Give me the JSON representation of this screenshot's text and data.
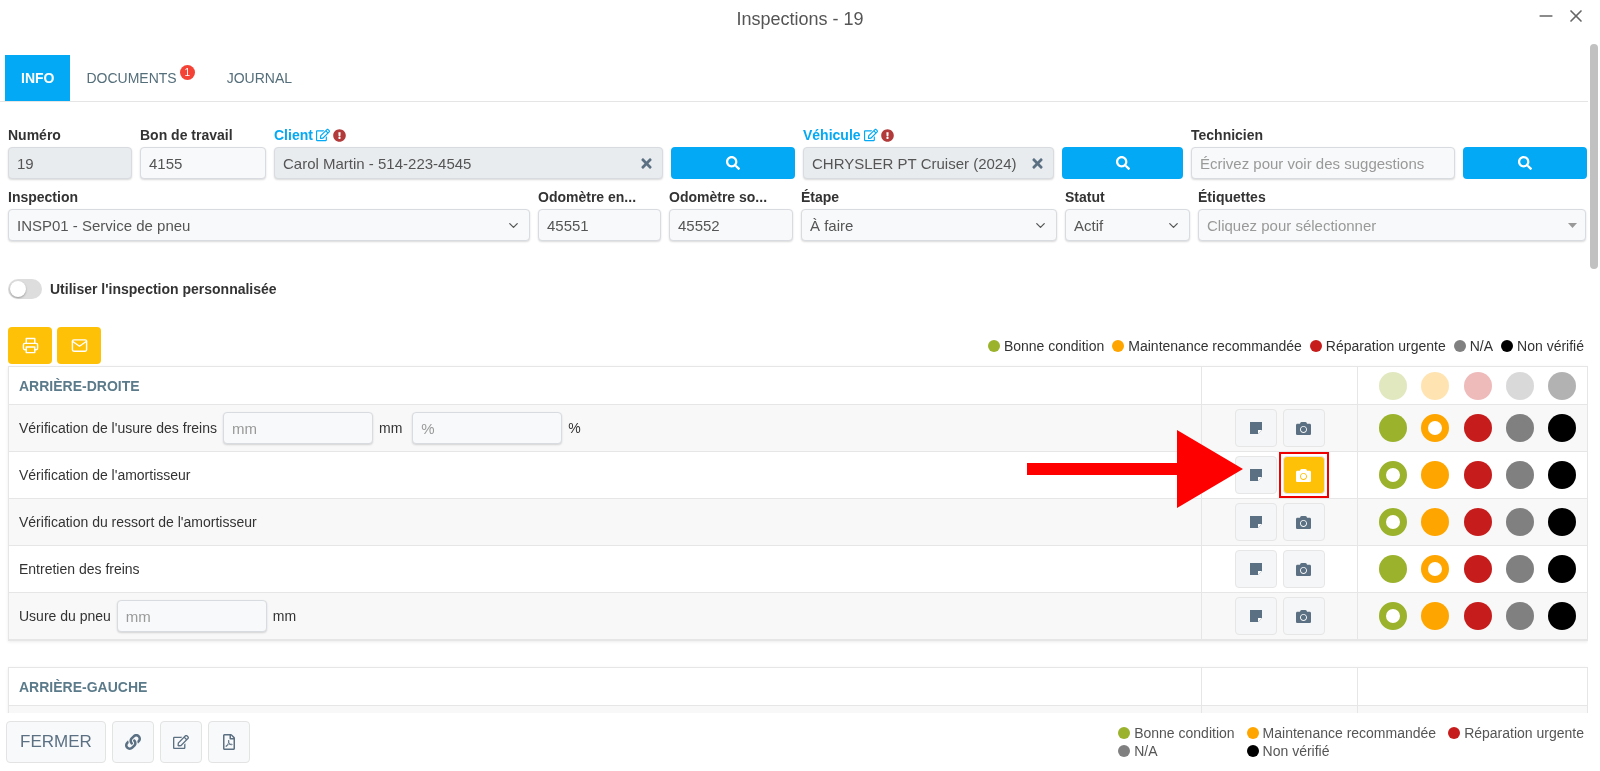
{
  "window": {
    "title": "Inspections - 19"
  },
  "tabs": [
    {
      "label": "INFO",
      "selected": true
    },
    {
      "label": "DOCUMENTS",
      "selected": false,
      "badge": "1"
    },
    {
      "label": "JOURNAL",
      "selected": false
    }
  ],
  "form": {
    "fields_top": [
      {
        "kind": "text",
        "label": "Numéro",
        "value": "19",
        "disabled": true
      },
      {
        "kind": "text",
        "label": "Bon de travail",
        "value": "4155",
        "disabled": false
      },
      {
        "kind": "lookup",
        "label": "Client",
        "value": "Carol Martin - 514-223-4545"
      },
      {
        "kind": "search"
      },
      {
        "kind": "lookup",
        "label": "Véhicule",
        "value": "CHRYSLER PT Cruiser (2024)"
      },
      {
        "kind": "search"
      },
      {
        "kind": "text",
        "label": "Technicien",
        "placeholder": "Écrivez pour voir des suggestions",
        "disabled": false
      },
      {
        "kind": "search"
      }
    ],
    "fields_bottom": [
      {
        "kind": "select",
        "label": "Inspection",
        "value": "INSP01 - Service de pneu"
      },
      {
        "kind": "text",
        "label": "Odomètre en...",
        "value": "45551",
        "disabled": false
      },
      {
        "kind": "text",
        "label": "Odomètre so...",
        "value": "45552",
        "disabled": false
      },
      {
        "kind": "select",
        "label": "Étape",
        "value": "À faire"
      },
      {
        "kind": "select",
        "label": "Statut",
        "value": "Actif"
      },
      {
        "kind": "tags",
        "label": "Étiquettes",
        "placeholder": "Cliquez pour sélectionner"
      }
    ]
  },
  "custom_toggle": {
    "label": "Utiliser l'inspection personnalisée",
    "on": false
  },
  "legend": [
    {
      "label": "Bonne condition",
      "color": "#9ab22c"
    },
    {
      "label": "Maintenance recommandée",
      "color": "#ffa500"
    },
    {
      "label": "Réparation urgente",
      "color": "#c71c1c"
    },
    {
      "label": "N/A",
      "color": "#808080"
    },
    {
      "label": "Non vérifié",
      "color": "#000000"
    }
  ],
  "sections": [
    {
      "title": "ARRIÈRE-DROITE",
      "items": [
        {
          "label": "Vérification de l'usure des freins",
          "measures": [
            {
              "placeholder": "mm",
              "unit": "mm"
            },
            {
              "placeholder": "%",
              "unit": "%"
            }
          ],
          "photo_highlighted": false,
          "conditions": [
            {
              "selected": false
            },
            {
              "selected": true
            },
            {
              "selected": false
            },
            {
              "selected": false
            },
            {
              "selected": false
            }
          ]
        },
        {
          "label": "Vérification de l'amortisseur",
          "photo_highlighted": true,
          "conditions": [
            {
              "selected": true
            },
            {
              "selected": false
            },
            {
              "selected": false
            },
            {
              "selected": false
            },
            {
              "selected": false
            }
          ]
        },
        {
          "label": "Vérification du ressort de l'amortisseur",
          "photo_highlighted": false,
          "conditions": [
            {
              "selected": true
            },
            {
              "selected": false
            },
            {
              "selected": false
            },
            {
              "selected": false
            },
            {
              "selected": false
            }
          ]
        },
        {
          "label": "Entretien des freins",
          "photo_highlighted": false,
          "conditions": [
            {
              "selected": false
            },
            {
              "selected": true
            },
            {
              "selected": false
            },
            {
              "selected": false
            },
            {
              "selected": false
            }
          ]
        },
        {
          "label": "Usure du pneu",
          "measures": [
            {
              "placeholder": "mm",
              "unit": "mm"
            }
          ],
          "photo_highlighted": false,
          "conditions": [
            {
              "selected": true
            },
            {
              "selected": false
            },
            {
              "selected": false
            },
            {
              "selected": false
            },
            {
              "selected": false
            }
          ]
        }
      ]
    },
    {
      "title": "ARRIÈRE-GAUCHE"
    }
  ],
  "footer": {
    "close_button": "FERMER",
    "legend": [
      {
        "label": "Bonne condition",
        "color": "#9ab22c"
      },
      {
        "label": "Maintenance recommandée",
        "color": "#ffa500"
      },
      {
        "label": "Réparation urgente",
        "color": "#c71c1c"
      },
      {
        "label": "N/A",
        "color": "#808080"
      },
      {
        "label": "Non vérifié",
        "color": "#000000"
      }
    ]
  }
}
